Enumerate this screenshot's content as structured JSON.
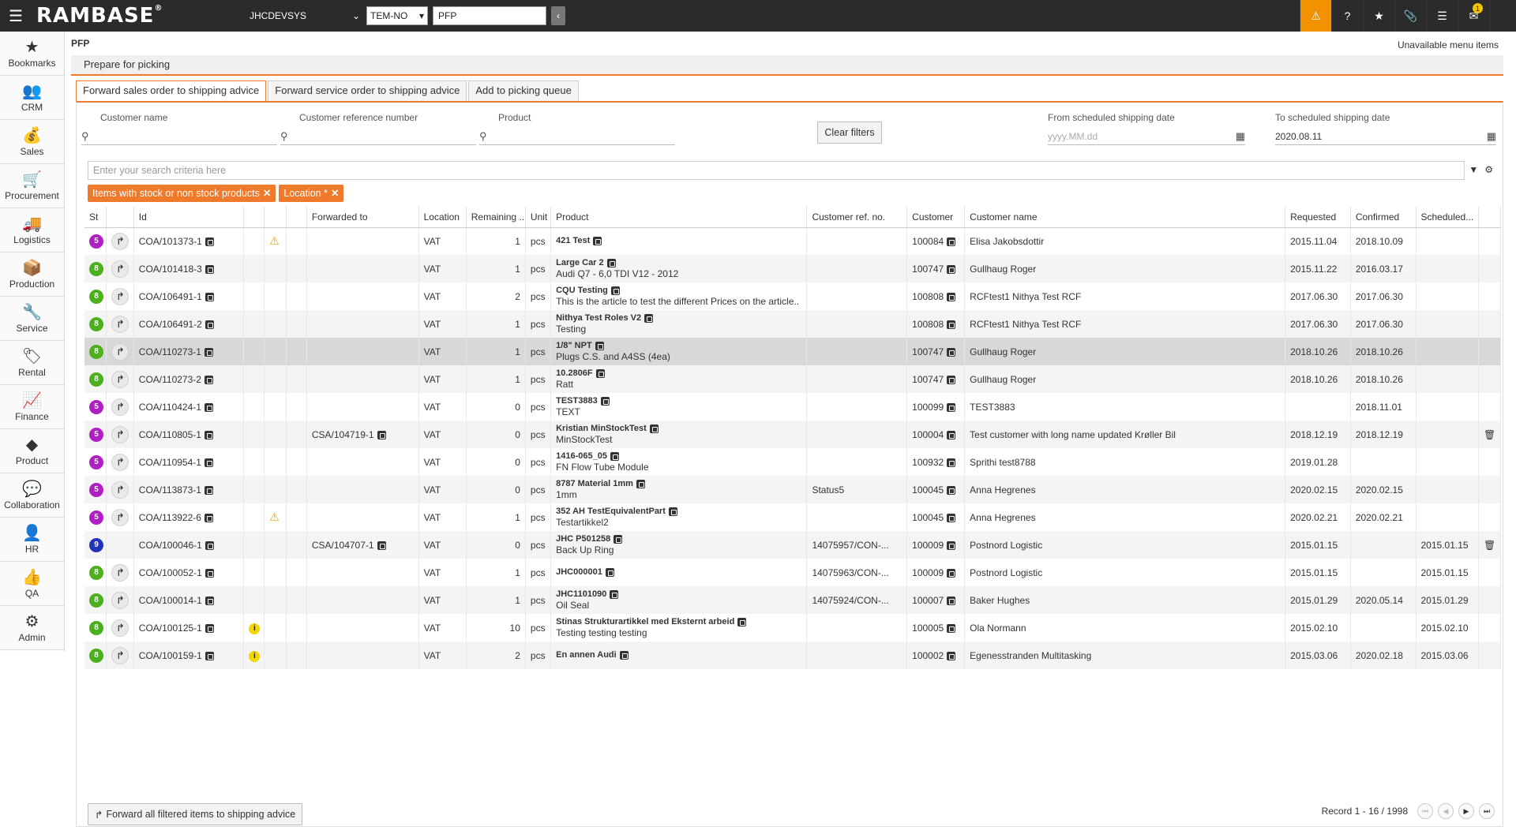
{
  "topbar": {
    "logo": "RAMBASE",
    "system": "JHCDEVSYS",
    "company": "TEM-NO",
    "search_value": "PFP",
    "notification_count": "1"
  },
  "sidebar": {
    "items": [
      {
        "label": "Bookmarks",
        "icon": "star-icon",
        "glyph": "★"
      },
      {
        "label": "CRM",
        "icon": "people-icon",
        "glyph": "👥"
      },
      {
        "label": "Sales",
        "icon": "money-bag-icon",
        "glyph": "💰"
      },
      {
        "label": "Procurement",
        "icon": "cart-icon",
        "glyph": "🛒"
      },
      {
        "label": "Logistics",
        "icon": "truck-icon",
        "glyph": "🚚"
      },
      {
        "label": "Production",
        "icon": "boxes-icon",
        "glyph": "📦"
      },
      {
        "label": "Service",
        "icon": "wrench-icon",
        "glyph": "🔧"
      },
      {
        "label": "Rental",
        "icon": "rental-icon",
        "glyph": "🏷"
      },
      {
        "label": "Finance",
        "icon": "chart-line-icon",
        "glyph": "📈"
      },
      {
        "label": "Product",
        "icon": "cube-icon",
        "glyph": "◆"
      },
      {
        "label": "Collaboration",
        "icon": "chat-icon",
        "glyph": "💬"
      },
      {
        "label": "HR",
        "icon": "person-icon",
        "glyph": "👤"
      },
      {
        "label": "QA",
        "icon": "thumbs-up-icon",
        "glyph": "👍"
      },
      {
        "label": "Admin",
        "icon": "gear-icon",
        "glyph": "⚙"
      }
    ]
  },
  "page": {
    "code": "PFP",
    "unavailable": "Unavailable menu items",
    "title": "Prepare for picking"
  },
  "tabs": [
    {
      "label": "Forward sales order to shipping advice"
    },
    {
      "label": "Forward service order to shipping advice"
    },
    {
      "label": "Add to picking queue"
    }
  ],
  "filters": {
    "customer_name": {
      "label": "Customer name",
      "value": ""
    },
    "customer_ref": {
      "label": "Customer reference number",
      "value": ""
    },
    "product": {
      "label": "Product",
      "value": ""
    },
    "clear": "Clear filters",
    "from_date": {
      "label": "From scheduled shipping date",
      "placeholder": "yyyy.MM.dd",
      "value": ""
    },
    "to_date": {
      "label": "To scheduled shipping date",
      "value": "2020.08.11"
    }
  },
  "search": {
    "placeholder": "Enter your search criteria here"
  },
  "chips": [
    "Items with stock or non stock products",
    "Location *"
  ],
  "columns": {
    "st": "St",
    "id": "Id",
    "forwarded": "Forwarded to",
    "location": "Location",
    "remaining": "Remaining ...",
    "unit": "Unit",
    "product": "Product",
    "custref": "Customer ref. no.",
    "customer": "Customer",
    "custname": "Customer name",
    "requested": "Requested",
    "confirmed": "Confirmed",
    "scheduled": "Scheduled..."
  },
  "rows": [
    {
      "st": "5",
      "color": "#b01fc4",
      "id": "COA/101373-1",
      "warn": true,
      "info": false,
      "fwdto": "",
      "loc": "VAT",
      "rem": "1",
      "unit": "pcs",
      "pname": "421 Test",
      "pdesc": "",
      "custref": "",
      "cust": "100084",
      "cname": "Elisa Jakobsdottir",
      "req": "2015.11.04",
      "conf": "2018.10.09",
      "sched": "",
      "trash": false,
      "fwd": true
    },
    {
      "st": "8",
      "color": "#4caf1e",
      "id": "COA/101418-3",
      "warn": false,
      "info": false,
      "fwdto": "",
      "loc": "VAT",
      "rem": "1",
      "unit": "pcs",
      "pname": "Large Car 2",
      "pdesc": "Audi Q7 - 6,0 TDI V12 - 2012",
      "custref": "",
      "cust": "100747",
      "cname": "Gullhaug Roger",
      "req": "2015.11.22",
      "conf": "2016.03.17",
      "sched": "",
      "trash": false,
      "fwd": true
    },
    {
      "st": "8",
      "color": "#4caf1e",
      "id": "COA/106491-1",
      "warn": false,
      "info": false,
      "fwdto": "",
      "loc": "VAT",
      "rem": "2",
      "unit": "pcs",
      "pname": "CQU Testing",
      "pdesc": "This is the article to test the different Prices on the article..",
      "custref": "",
      "cust": "100808",
      "cname": "RCFtest1 Nithya Test RCF",
      "req": "2017.06.30",
      "conf": "2017.06.30",
      "sched": "",
      "trash": false,
      "fwd": true
    },
    {
      "st": "8",
      "color": "#4caf1e",
      "id": "COA/106491-2",
      "warn": false,
      "info": false,
      "fwdto": "",
      "loc": "VAT",
      "rem": "1",
      "unit": "pcs",
      "pname": "Nithya Test Roles V2",
      "pdesc": "Testing",
      "custref": "",
      "cust": "100808",
      "cname": "RCFtest1 Nithya Test RCF",
      "req": "2017.06.30",
      "conf": "2017.06.30",
      "sched": "",
      "trash": false,
      "fwd": true
    },
    {
      "st": "8",
      "color": "#4caf1e",
      "id": "COA/110273-1",
      "warn": false,
      "info": false,
      "fwdto": "",
      "loc": "VAT",
      "rem": "1",
      "unit": "pcs",
      "pname": "1/8\" NPT",
      "pdesc": "Plugs C.S. and A4SS (4ea)",
      "custref": "",
      "cust": "100747",
      "cname": "Gullhaug Roger",
      "req": "2018.10.26",
      "conf": "2018.10.26",
      "sched": "",
      "trash": false,
      "fwd": true,
      "selected": true
    },
    {
      "st": "8",
      "color": "#4caf1e",
      "id": "COA/110273-2",
      "warn": false,
      "info": false,
      "fwdto": "",
      "loc": "VAT",
      "rem": "1",
      "unit": "pcs",
      "pname": "10.2806F",
      "pdesc": "Ratt",
      "custref": "",
      "cust": "100747",
      "cname": "Gullhaug Roger",
      "req": "2018.10.26",
      "conf": "2018.10.26",
      "sched": "",
      "trash": false,
      "fwd": true
    },
    {
      "st": "5",
      "color": "#b01fc4",
      "id": "COA/110424-1",
      "warn": false,
      "info": false,
      "fwdto": "",
      "loc": "VAT",
      "rem": "0",
      "unit": "pcs",
      "pname": "TEST3883",
      "pdesc": "TEXT",
      "custref": "",
      "cust": "100099",
      "cname": "TEST3883",
      "req": "",
      "conf": "2018.11.01",
      "sched": "",
      "trash": false,
      "fwd": true
    },
    {
      "st": "5",
      "color": "#b01fc4",
      "id": "COA/110805-1",
      "warn": false,
      "info": false,
      "fwdto": "CSA/104719-1",
      "loc": "VAT",
      "rem": "0",
      "unit": "pcs",
      "pname": "Kristian MinStockTest",
      "pdesc": "MinStockTest",
      "custref": "",
      "cust": "100004",
      "cname": "Test customer with long name updated Krøller Bil",
      "req": "2018.12.19",
      "conf": "2018.12.19",
      "sched": "",
      "trash": true,
      "fwd": true
    },
    {
      "st": "5",
      "color": "#b01fc4",
      "id": "COA/110954-1",
      "warn": false,
      "info": false,
      "fwdto": "",
      "loc": "VAT",
      "rem": "0",
      "unit": "pcs",
      "pname": "1416-065_05",
      "pdesc": "FN Flow Tube Module",
      "custref": "",
      "cust": "100932",
      "cname": "Sprithi test8788",
      "req": "2019.01.28",
      "conf": "",
      "sched": "",
      "trash": false,
      "fwd": true
    },
    {
      "st": "5",
      "color": "#b01fc4",
      "id": "COA/113873-1",
      "warn": false,
      "info": false,
      "fwdto": "",
      "loc": "VAT",
      "rem": "0",
      "unit": "pcs",
      "pname": "8787 Material 1mm",
      "pdesc": "1mm",
      "custref": "Status5",
      "cust": "100045",
      "cname": "Anna Hegrenes",
      "req": "2020.02.15",
      "conf": "2020.02.15",
      "sched": "",
      "trash": false,
      "fwd": true
    },
    {
      "st": "5",
      "color": "#b01fc4",
      "id": "COA/113922-6",
      "warn": true,
      "info": false,
      "fwdto": "",
      "loc": "VAT",
      "rem": "1",
      "unit": "pcs",
      "pname": "352 AH TestEquivalentPart",
      "pdesc": "Testartikkel2",
      "custref": "",
      "cust": "100045",
      "cname": "Anna Hegrenes",
      "req": "2020.02.21",
      "conf": "2020.02.21",
      "sched": "",
      "trash": false,
      "fwd": true
    },
    {
      "st": "9",
      "color": "#2233bb",
      "id": "COA/100046-1",
      "warn": false,
      "info": false,
      "fwdto": "CSA/104707-1",
      "loc": "VAT",
      "rem": "0",
      "unit": "pcs",
      "pname": "JHC P501258",
      "pdesc": "Back Up Ring",
      "custref": "14075957/CON-...",
      "cust": "100009",
      "cname": "Postnord Logistic",
      "req": "2015.01.15",
      "conf": "",
      "sched": "2015.01.15",
      "trash": true,
      "fwd": false
    },
    {
      "st": "8",
      "color": "#4caf1e",
      "id": "COA/100052-1",
      "warn": false,
      "info": false,
      "fwdto": "",
      "loc": "VAT",
      "rem": "1",
      "unit": "pcs",
      "pname": "JHC000001",
      "pdesc": "",
      "custref": "14075963/CON-...",
      "cust": "100009",
      "cname": "Postnord Logistic",
      "req": "2015.01.15",
      "conf": "",
      "sched": "2015.01.15",
      "trash": false,
      "fwd": true
    },
    {
      "st": "8",
      "color": "#4caf1e",
      "id": "COA/100014-1",
      "warn": false,
      "info": false,
      "fwdto": "",
      "loc": "VAT",
      "rem": "1",
      "unit": "pcs",
      "pname": "JHC1101090",
      "pdesc": "Oil Seal",
      "custref": "14075924/CON-...",
      "cust": "100007",
      "cname": "Baker Hughes",
      "req": "2015.01.29",
      "conf": "2020.05.14",
      "sched": "2015.01.29",
      "trash": false,
      "fwd": true
    },
    {
      "st": "8",
      "color": "#4caf1e",
      "id": "COA/100125-1",
      "warn": false,
      "info": true,
      "fwdto": "",
      "loc": "VAT",
      "rem": "10",
      "unit": "pcs",
      "pname": "Stinas Strukturartikkel med Eksternt arbeid",
      "pdesc": "Testing testing testing",
      "custref": "",
      "cust": "100005",
      "cname": "Ola Normann",
      "req": "2015.02.10",
      "conf": "",
      "sched": "2015.02.10",
      "trash": false,
      "fwd": true
    },
    {
      "st": "8",
      "color": "#4caf1e",
      "id": "COA/100159-1",
      "warn": false,
      "info": true,
      "fwdto": "",
      "loc": "VAT",
      "rem": "2",
      "unit": "pcs",
      "pname": "En annen Audi",
      "pdesc": "",
      "custref": "",
      "cust": "100002",
      "cname": "Egenesstranden Multitasking",
      "req": "2015.03.06",
      "conf": "2020.02.18",
      "sched": "2015.03.06",
      "trash": false,
      "fwd": true
    }
  ],
  "pager": {
    "record": "Record 1 - 16 / 1998"
  },
  "bottom_button": "Forward all filtered items to shipping advice"
}
